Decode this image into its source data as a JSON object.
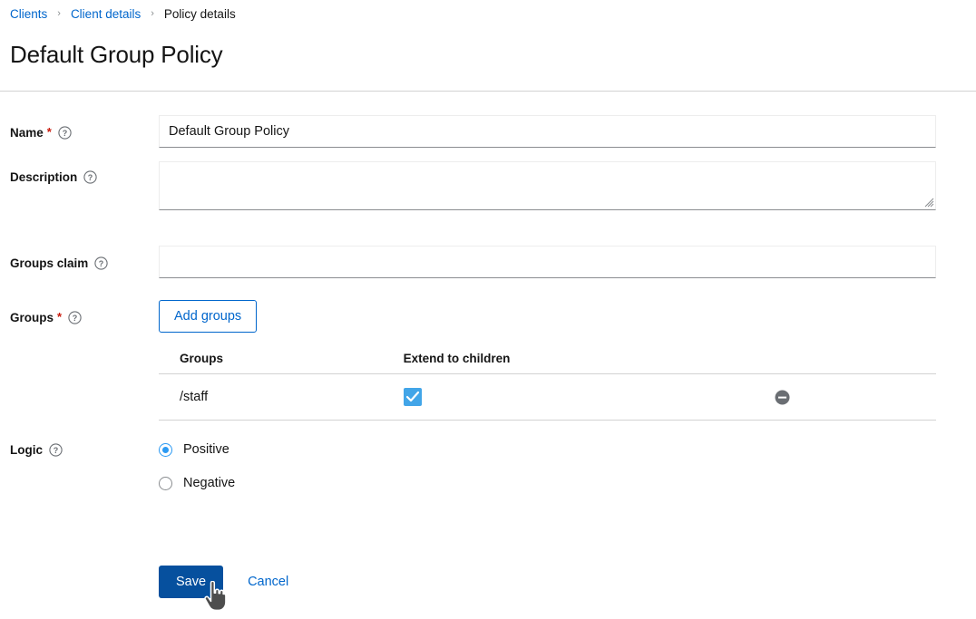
{
  "breadcrumb": {
    "items": [
      {
        "label": "Clients",
        "type": "link"
      },
      {
        "label": "Client details",
        "type": "link"
      },
      {
        "label": "Policy details",
        "type": "current"
      }
    ],
    "separator": "›"
  },
  "page": {
    "title": "Default Group Policy"
  },
  "form": {
    "name": {
      "label": "Name",
      "required_marker": "*",
      "help": "?",
      "value": "Default Group Policy",
      "placeholder": ""
    },
    "description": {
      "label": "Description",
      "help": "?",
      "value": "",
      "placeholder": ""
    },
    "groups_claim": {
      "label": "Groups claim",
      "help": "?",
      "value": "",
      "placeholder": ""
    },
    "groups": {
      "label": "Groups",
      "required_marker": "*",
      "help": "?",
      "add_button_label": "Add groups",
      "table": {
        "headers": [
          "Groups",
          "Extend to children",
          ""
        ],
        "rows": [
          {
            "group": "/staff",
            "extend_to_children": true,
            "remove_label": "Remove"
          }
        ]
      }
    },
    "logic": {
      "label": "Logic",
      "help": "?",
      "options": [
        {
          "label": "Positive",
          "selected": true
        },
        {
          "label": "Negative",
          "selected": false
        }
      ]
    }
  },
  "actions": {
    "save_label": "Save",
    "cancel_label": "Cancel"
  },
  "colors": {
    "link": "#0066cc",
    "primary_button": "#06509e",
    "checkbox": "#42a5e8",
    "radio_selected": "#2b9af3",
    "required_asterisk": "#c9190b",
    "border": "#d2d2d2"
  }
}
